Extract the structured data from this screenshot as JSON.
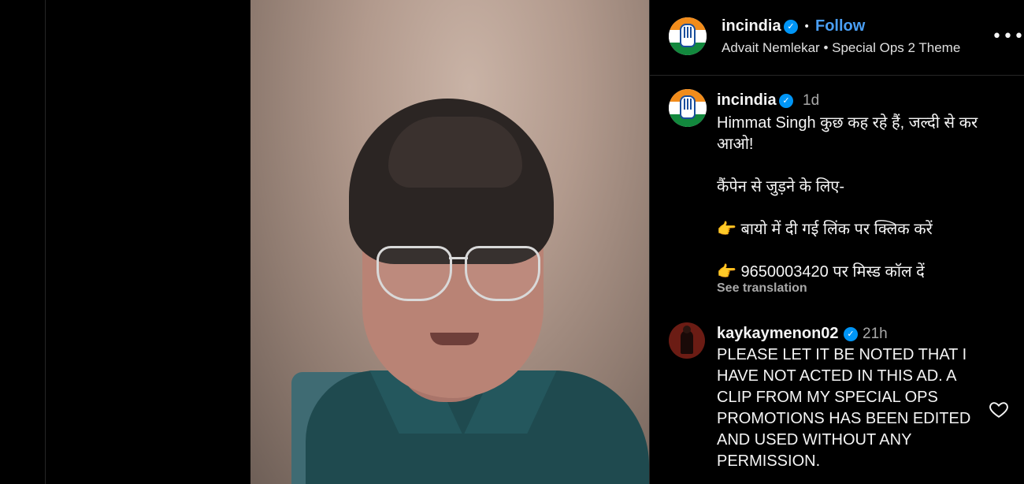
{
  "header": {
    "username": "incindia",
    "follow_label": "Follow",
    "separator": "•",
    "audio_artist": "Advait Nemlekar",
    "audio_track": "Special Ops 2 Theme",
    "more_label": "•••"
  },
  "caption": {
    "username": "incindia",
    "time": "1d",
    "lines": [
      "Himmat Singh कुछ कह रहे हैं, जल्दी से कर आओ!",
      "कैंपेन से जुड़ने के लिए-",
      "👉  बायो में दी गई लिंक पर क्लिक करें",
      "👉  9650003420 पर मिस्ड कॉल दें"
    ],
    "see_translation": "See translation"
  },
  "comment": {
    "username": "kaykaymenon02",
    "time": "21h",
    "text": "PLEASE LET IT BE NOTED THAT I HAVE NOT ACTED IN THIS AD. A CLIP FROM MY SPECIAL OPS PROMOTIONS HAS BEEN EDITED AND USED WITHOUT ANY PERMISSION."
  },
  "colors": {
    "accent_follow": "#4a9ff5",
    "verified": "#0095f6",
    "background": "#000000"
  }
}
